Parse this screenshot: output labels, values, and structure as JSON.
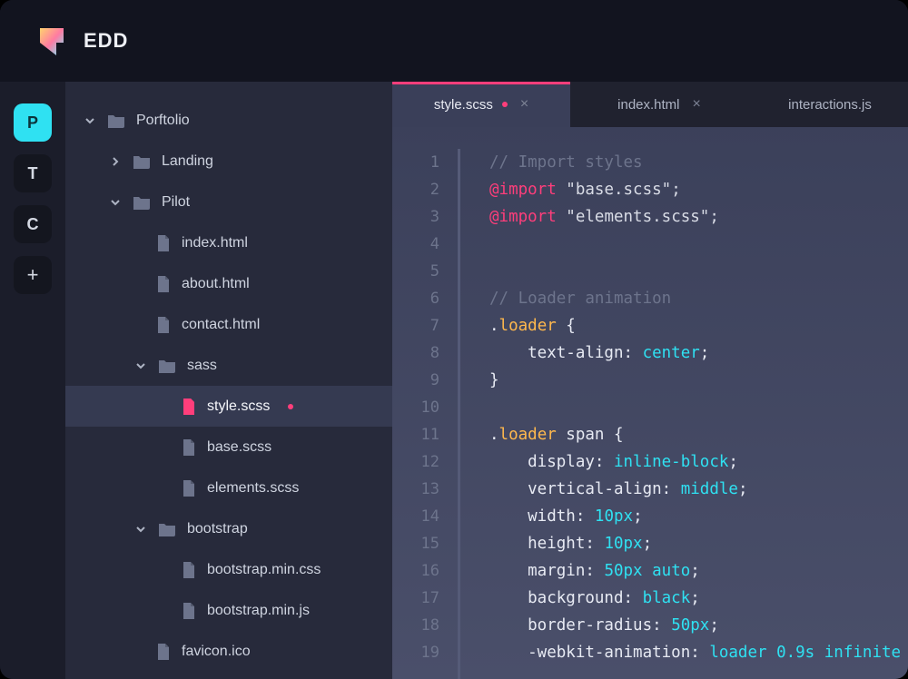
{
  "app": {
    "name": "EDD"
  },
  "activity": {
    "items": [
      {
        "label": "P",
        "selected": true
      },
      {
        "label": "T",
        "selected": false
      },
      {
        "label": "C",
        "selected": false
      }
    ],
    "add": "+"
  },
  "tree": {
    "root": {
      "name": "Porftolio",
      "expanded": true,
      "children": [
        {
          "name": "Landing",
          "type": "folder",
          "expanded": false
        },
        {
          "name": "Pilot",
          "type": "folder",
          "expanded": true,
          "children": [
            {
              "name": "index.html",
              "type": "file"
            },
            {
              "name": "about.html",
              "type": "file"
            },
            {
              "name": "contact.html",
              "type": "file"
            },
            {
              "name": "sass",
              "type": "folder",
              "expanded": true,
              "children": [
                {
                  "name": "style.scss",
                  "type": "file",
                  "selected": true,
                  "dirty": true
                },
                {
                  "name": "base.scss",
                  "type": "file"
                },
                {
                  "name": "elements.scss",
                  "type": "file"
                }
              ]
            },
            {
              "name": "bootstrap",
              "type": "folder",
              "expanded": true,
              "children": [
                {
                  "name": "bootstrap.min.css",
                  "type": "file"
                },
                {
                  "name": "bootstrap.min.js",
                  "type": "file"
                }
              ]
            },
            {
              "name": "favicon.ico",
              "type": "file"
            }
          ]
        }
      ]
    }
  },
  "tabs": [
    {
      "label": "style.scss",
      "active": true,
      "dirty": true
    },
    {
      "label": "index.html",
      "active": false,
      "closeable": true
    },
    {
      "label": "interactions.js",
      "active": false
    }
  ],
  "code": {
    "lines": [
      {
        "segments": [
          {
            "t": "// Import styles",
            "c": "comment"
          }
        ]
      },
      {
        "segments": [
          {
            "t": "@import",
            "c": "keyword"
          },
          {
            "t": " \"base.scss\";",
            "c": "string"
          }
        ]
      },
      {
        "segments": [
          {
            "t": "@import",
            "c": "keyword"
          },
          {
            "t": " \"elements.scss\";",
            "c": "string"
          }
        ]
      },
      {
        "segments": []
      },
      {
        "segments": []
      },
      {
        "segments": [
          {
            "t": "// Loader animation",
            "c": "comment"
          }
        ]
      },
      {
        "segments": [
          {
            "t": ".",
            "c": "brace"
          },
          {
            "t": "loader",
            "c": "class"
          },
          {
            "t": " {",
            "c": "brace"
          }
        ]
      },
      {
        "segments": [
          {
            "t": "    text-align: ",
            "c": "prop"
          },
          {
            "t": "center",
            "c": "value"
          },
          {
            "t": ";",
            "c": "brace"
          }
        ]
      },
      {
        "segments": [
          {
            "t": "}",
            "c": "brace"
          }
        ]
      },
      {
        "segments": []
      },
      {
        "segments": [
          {
            "t": ".",
            "c": "brace"
          },
          {
            "t": "loader",
            "c": "class"
          },
          {
            "t": " span",
            "c": "prop"
          },
          {
            "t": " {",
            "c": "brace"
          }
        ]
      },
      {
        "segments": [
          {
            "t": "    display: ",
            "c": "prop"
          },
          {
            "t": "inline-block",
            "c": "value"
          },
          {
            "t": ";",
            "c": "brace"
          }
        ]
      },
      {
        "segments": [
          {
            "t": "    vertical-align: ",
            "c": "prop"
          },
          {
            "t": "middle",
            "c": "value"
          },
          {
            "t": ";",
            "c": "brace"
          }
        ]
      },
      {
        "segments": [
          {
            "t": "    width: ",
            "c": "prop"
          },
          {
            "t": "10px",
            "c": "value"
          },
          {
            "t": ";",
            "c": "brace"
          }
        ]
      },
      {
        "segments": [
          {
            "t": "    height: ",
            "c": "prop"
          },
          {
            "t": "10px",
            "c": "value"
          },
          {
            "t": ";",
            "c": "brace"
          }
        ]
      },
      {
        "segments": [
          {
            "t": "    margin: ",
            "c": "prop"
          },
          {
            "t": "50px auto",
            "c": "value"
          },
          {
            "t": ";",
            "c": "brace"
          }
        ]
      },
      {
        "segments": [
          {
            "t": "    background: ",
            "c": "prop"
          },
          {
            "t": "black",
            "c": "value"
          },
          {
            "t": ";",
            "c": "brace"
          }
        ]
      },
      {
        "segments": [
          {
            "t": "    border-radius: ",
            "c": "prop"
          },
          {
            "t": "50px",
            "c": "value"
          },
          {
            "t": ";",
            "c": "brace"
          }
        ]
      },
      {
        "segments": [
          {
            "t": "    -webkit-animation: ",
            "c": "prop"
          },
          {
            "t": "loader 0.9s infinite",
            "c": "value"
          }
        ]
      }
    ]
  }
}
